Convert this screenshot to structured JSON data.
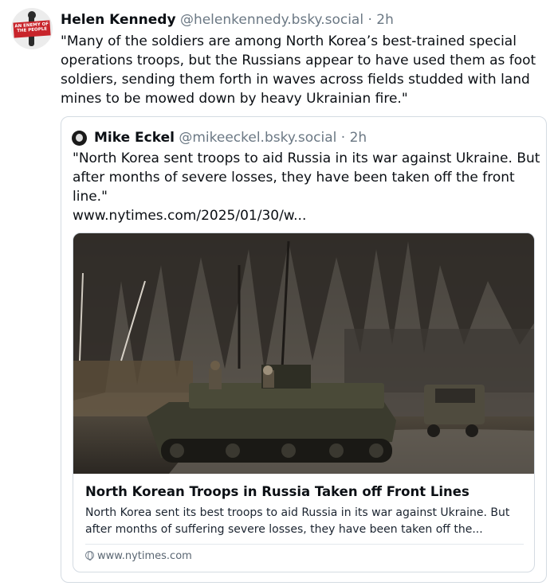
{
  "post": {
    "author_name": "Helen Kennedy",
    "handle": "@helenkennedy.bsky.social",
    "separator": "·",
    "time": "2h",
    "avatar_text": "AN ENEMY OF THE PEOPLE",
    "text": "\"Many of the soldiers are among North Korea’s best-trained special operations troops, but the Russians appear to have used them as foot soldiers, sending them forth in waves across fields studded with land mines to be mowed down by heavy Ukrainian fire.\""
  },
  "quote": {
    "author_name": "Mike Eckel",
    "handle": "@mikeeckel.bsky.social",
    "separator": "·",
    "time": "2h",
    "text": "\"North Korea sent troops to aid Russia in its war against Ukraine. But after months of severe losses, they have been taken off the front line.\"",
    "link": "www.nytimes.com/2025/01/30/w..."
  },
  "embed": {
    "title": "North Korean Troops in Russia Taken off Front Lines",
    "description": "North Korea sent its best troops to aid Russia in its war against Ukraine. But after months of suffering severe losses, they have been taken off the...",
    "domain": "www.nytimes.com",
    "domain_icon": "globe-icon"
  },
  "colors": {
    "text": "#0b0f14",
    "muted": "#6b7884",
    "border": "#d4dbe2",
    "avatar_banner": "#c8242b"
  }
}
